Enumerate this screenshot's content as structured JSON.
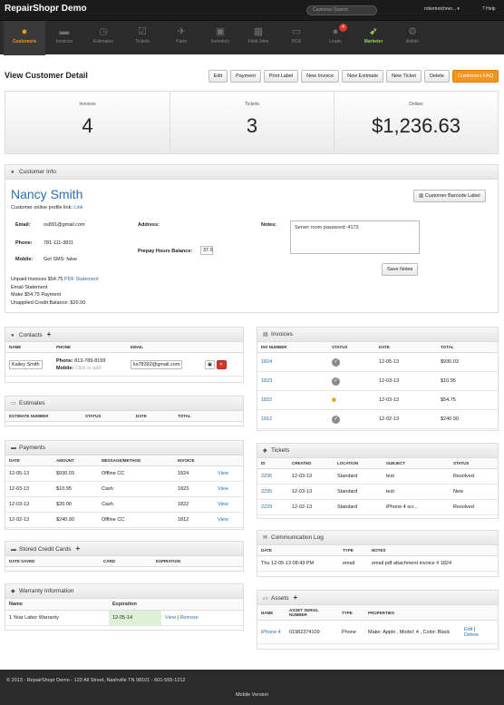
{
  "topbar": {
    "brand": "RepairShopr Demo",
    "search_placeholder": "Customer Search",
    "user": "robertreichner...",
    "help": "Help"
  },
  "nav": [
    {
      "label": "Customers",
      "icon": "user-icon"
    },
    {
      "label": "Invoices",
      "icon": "cart-icon"
    },
    {
      "label": "Estimates",
      "icon": "clock-icon"
    },
    {
      "label": "Tickets",
      "icon": "check-square-icon"
    },
    {
      "label": "Parts",
      "icon": "plane-icon"
    },
    {
      "label": "Inventory",
      "icon": "box-icon"
    },
    {
      "label": "Field Jobs",
      "icon": "grid-icon"
    },
    {
      "label": "POS",
      "icon": "monitor-icon"
    },
    {
      "label": "Leads",
      "icon": "person-icon",
      "badge": "4"
    },
    {
      "label": "Marketer",
      "icon": "rocket-icon"
    },
    {
      "label": "Admin",
      "icon": "gear-icon"
    }
  ],
  "page": {
    "title": "View Customer Detail"
  },
  "toolbar": [
    "Edit",
    "Payment",
    "Print Label",
    "New Invoice",
    "New Estimate",
    "New Ticket",
    "Delete",
    "Customers FAQ"
  ],
  "stats": [
    {
      "label": "Invoices",
      "value": "4"
    },
    {
      "label": "Tickets",
      "value": "3"
    },
    {
      "label": "Dollars",
      "value": "$1,236.63"
    }
  ],
  "customer": {
    "panel_title": "Customer Info",
    "name": "Nancy Smith",
    "profile_prefix": "Customer online profile link:",
    "profile_link": "Link",
    "barcode_button": "Customer Barcode Label",
    "email_label": "Email:",
    "email": "ns891@gmail.com",
    "phone_label": "Phone:",
    "phone": "781-111-3811",
    "mobile_label": "Mobile:",
    "mobile": "Get SMS: false",
    "address_label": "Address:",
    "prepay_label": "Prepay Hours Balance:",
    "prepay_value": "37.0",
    "notes_label": "Notes:",
    "notes_value": "Server room password: 4173",
    "save_notes": "Save Notes",
    "unpaid_prefix": "Unpaid Invoices $54.75",
    "pdf_statement": "PDF Statement",
    "email_statement": "Email Statement",
    "make_payment": "Make $54.75 Payment",
    "unapplied": "Unapplied Credit Balance: $20.00"
  },
  "contacts": {
    "title": "Contacts",
    "headers": [
      "NAME",
      "PHONE",
      "EMAIL"
    ],
    "name": "Kailey Smith",
    "phone_label": "Phone:",
    "phone": "813-789-8199",
    "mobile_label": "Mobile:",
    "mobile_placeholder": "Click to add",
    "email": "ks78392@gmail.com"
  },
  "estimates": {
    "title": "Estimates",
    "headers": [
      "ESTIMATE NUMBER",
      "STATUS",
      "DATE",
      "TOTAL"
    ]
  },
  "payments": {
    "title": "Payments",
    "headers": [
      "DATE",
      "AMOUNT",
      "MESSAGE/METHOD",
      "INVOICE",
      ""
    ],
    "rows": [
      [
        "12-05-13",
        "$930.03",
        "Offline CC",
        "1824",
        "View"
      ],
      [
        "12-03-13",
        "$10.95",
        "Cash",
        "1823",
        "View"
      ],
      [
        "12-03-13",
        "$20.00",
        "Cash",
        "1822",
        "View"
      ],
      [
        "12-02-13",
        "$240.90",
        "Offline CC",
        "1812",
        "View"
      ]
    ]
  },
  "cards": {
    "title": "Stored Credit Cards",
    "headers": [
      "DATE SAVED",
      "CARD",
      "EXPIRATION"
    ]
  },
  "warranty": {
    "title": "Warranty Information",
    "headers": [
      "Name",
      "Expiration"
    ],
    "row": {
      "name": "1 Year Labor Warranty",
      "expiration": "12-05-14",
      "view": "View",
      "sep": "|",
      "remove": "Remove"
    }
  },
  "invoices": {
    "title": "Invoices",
    "headers": [
      "INV NUMBER",
      "STATUS",
      "DATE",
      "TOTAL"
    ],
    "rows": [
      {
        "num": "1824",
        "status": "paid",
        "date": "12-05-13",
        "total": "$930.03"
      },
      {
        "num": "1823",
        "status": "paid",
        "date": "12-03-13",
        "total": "$10.95"
      },
      {
        "num": "1822",
        "status": "locked",
        "date": "12-03-13",
        "total": "$54.75"
      },
      {
        "num": "1812",
        "status": "paid",
        "date": "12-02-13",
        "total": "$240.90"
      }
    ]
  },
  "tickets": {
    "title": "Tickets",
    "headers": [
      "ID",
      "CREATED",
      "LOCATION",
      "SUBJECT",
      "STATUS"
    ],
    "rows": [
      [
        "2236",
        "12-03-13",
        "Standard",
        "test",
        "Resolved"
      ],
      [
        "2235",
        "12-03-13",
        "Standard",
        "test",
        "New"
      ],
      [
        "2229",
        "12-02-13",
        "Standard",
        "iPhone 4 scr...",
        "Resolved"
      ]
    ]
  },
  "commlog": {
    "title": "Communication Log",
    "headers": [
      "DATE",
      "TYPE",
      "NOTES"
    ],
    "row": [
      "Thu 12-05-13 08:43 PM",
      "email",
      "email pdf attachment invoice # 1824"
    ]
  },
  "assets": {
    "title": "Assets",
    "headers": [
      "NAME",
      "ASSET SERIAL NUMBER",
      "TYPE",
      "PROPERTIES",
      ""
    ],
    "row": {
      "name": "iPhone 4",
      "serial": "01982374109",
      "type": "Phone",
      "props": "Make: Apple , Model: 4 , Color: Black",
      "edit": "Edit",
      "sep": "|",
      "delete": "Delete"
    }
  },
  "footer": {
    "copy": "© 2013 - RepairShopr Demo - 123 All Street, Nashville TN 98101 - 601-555-1212",
    "mobile": "Mobile Version"
  }
}
